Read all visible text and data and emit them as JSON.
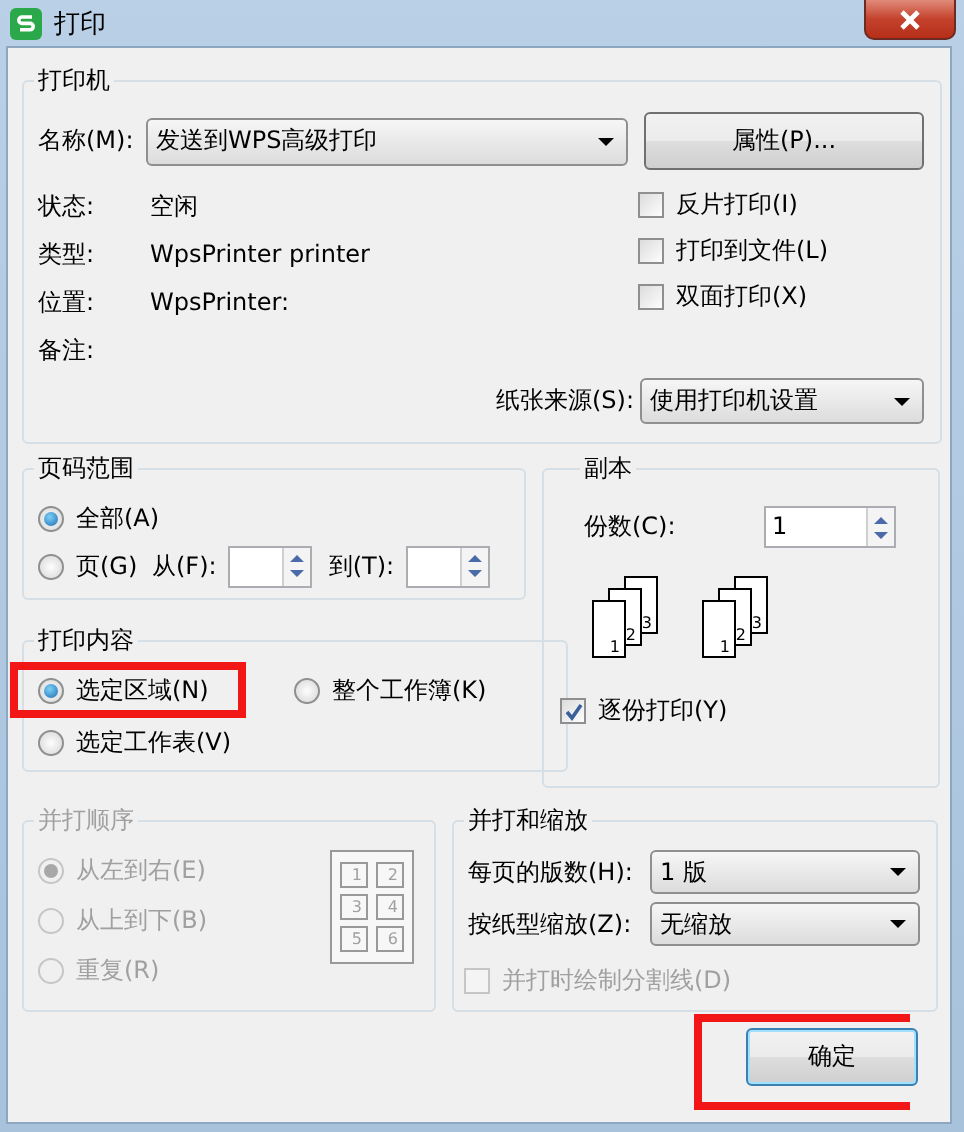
{
  "window": {
    "title": "打印"
  },
  "printer": {
    "title": "打印机",
    "name_label": "名称(M):",
    "name_value": "发送到WPS高级打印",
    "properties_button": "属性(P)...",
    "info": [
      {
        "label": "状态:",
        "value": "空闲"
      },
      {
        "label": "类型:",
        "value": "WpsPrinter printer"
      },
      {
        "label": "位置:",
        "value": "WpsPrinter:"
      },
      {
        "label": "备注:"
      }
    ],
    "options": [
      {
        "label": "反片打印(I)",
        "checked": false
      },
      {
        "label": "打印到文件(L)",
        "checked": false
      },
      {
        "label": "双面打印(X)",
        "checked": false
      }
    ],
    "source_label": "纸张来源(S):",
    "source_value": "使用打印机设置"
  },
  "page_range": {
    "title": "页码范围",
    "options": [
      {
        "label": "全部(A)",
        "selected": true
      },
      {
        "label": "页(G)",
        "selected": false
      }
    ],
    "from_label": "从(F):",
    "to_label": "到(T):"
  },
  "content": {
    "title": "打印内容",
    "options": [
      {
        "label": "选定区域(N)",
        "selected": true,
        "highlighted": true
      },
      {
        "label": "整个工作簿(K)",
        "selected": false,
        "highlighted": false
      },
      {
        "label": "选定工作表(V)",
        "selected": false,
        "highlighted": false
      }
    ]
  },
  "copies": {
    "title": "副本",
    "count_label": "份数(C):",
    "count_value": "1",
    "stacks": [
      [
        "1",
        "2",
        "3"
      ],
      [
        "1",
        "2",
        "3"
      ]
    ],
    "collate": {
      "label": "逐份打印(Y)",
      "checked": true
    }
  },
  "order": {
    "title": "并打顺序",
    "disabled": true,
    "options": [
      {
        "label": "从左到右(E)",
        "selected": true
      },
      {
        "label": "从上到下(B)",
        "selected": false
      },
      {
        "label": "重复(R)",
        "selected": false
      }
    ],
    "grid": [
      "1",
      "2",
      "3",
      "4",
      "5",
      "6"
    ]
  },
  "scaling": {
    "title": "并打和缩放",
    "rows": [
      {
        "label": "每页的版数(H):",
        "value": "1 版"
      },
      {
        "label": "按纸型缩放(Z):",
        "value": "无缩放"
      }
    ],
    "divider": {
      "label": "并打时绘制分割线(D)",
      "checked": false,
      "disabled": true
    }
  },
  "buttons": [
    {
      "label": "确定",
      "default": true,
      "highlighted": true
    }
  ]
}
